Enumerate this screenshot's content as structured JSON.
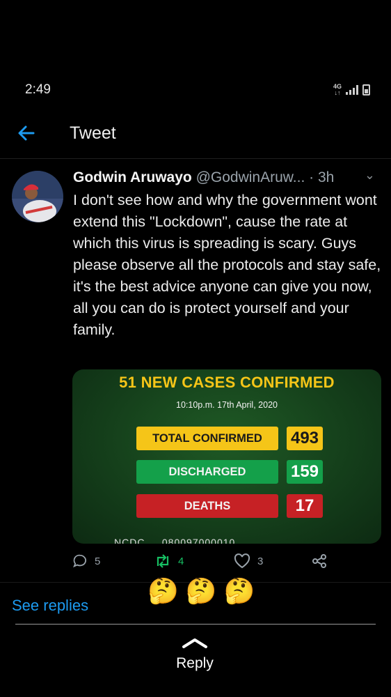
{
  "status": {
    "time": "2:49",
    "network": "4G"
  },
  "header": {
    "title": "Tweet"
  },
  "tweet": {
    "author_name": "Godwin Aruwayo",
    "handle": "@GodwinAruw...",
    "time": "· 3h",
    "text": "I don't see how  and why the government wont extend this \"Lockdown\", cause the rate at which this virus is spreading is scary. Guys please observe all the protocols and stay safe, it's the best advice anyone can give you now, all you can do is protect yourself and your family."
  },
  "media": {
    "headline": "51 NEW CASES CONFIRMED",
    "date": "10:10p.m. 17th April, 2020",
    "stats": [
      {
        "label": "TOTAL CONFIRMED",
        "value": "493"
      },
      {
        "label": "DISCHARGED",
        "value": "159"
      },
      {
        "label": "DEATHS",
        "value": "17"
      }
    ],
    "footer_partial": "NCDC ... 080097000010"
  },
  "actions": {
    "replies": "5",
    "retweets": "4",
    "likes": "3"
  },
  "emojis": [
    "🤔",
    "🤔",
    "🤔"
  ],
  "footer": {
    "see_replies": "See replies",
    "reply": "Reply"
  },
  "colors": {
    "accent": "#1d9bf0",
    "retweet": "#17bf63",
    "yellow": "#f5c518",
    "green": "#14a04a",
    "red": "#c62125"
  }
}
